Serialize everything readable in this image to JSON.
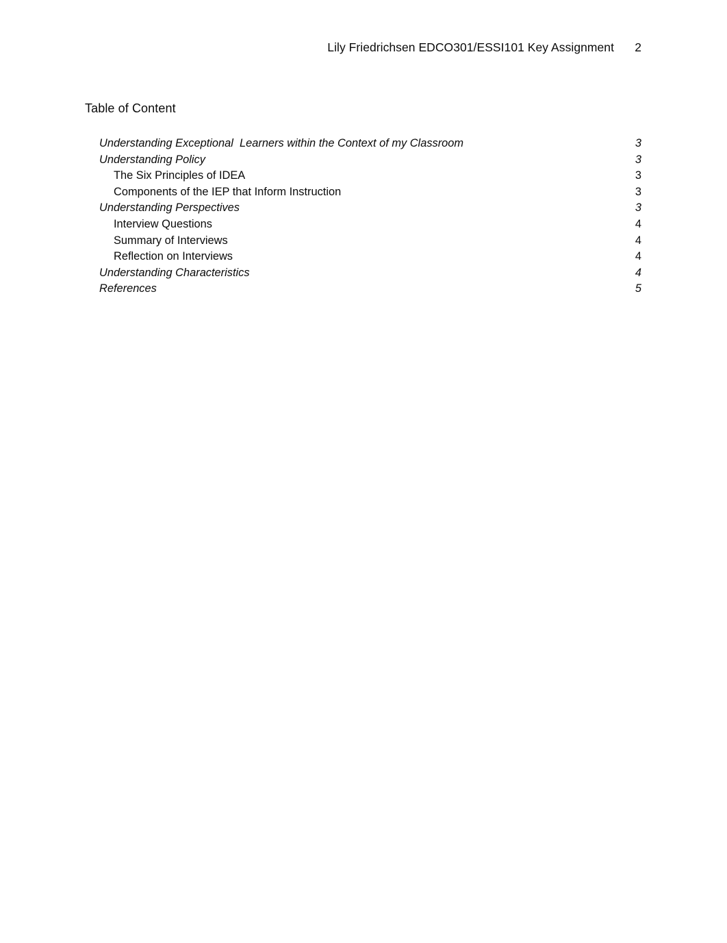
{
  "header": {
    "title": "Lily Friedrichsen EDCO301/ESSI101 Key Assignment",
    "page_number": "2"
  },
  "toc": {
    "heading": "Table of Content",
    "entries": [
      {
        "text": "Understanding Exceptional  Learners within the Context of my Classroom",
        "page": "3",
        "level": 1
      },
      {
        "text": "Understanding Policy",
        "page": "3",
        "level": 1
      },
      {
        "text": "The Six Principles of IDEA",
        "page": "3",
        "level": 2
      },
      {
        "text": "Components of the IEP that Inform Instruction",
        "page": "3",
        "level": 2
      },
      {
        "text": "Understanding Perspectives",
        "page": "3",
        "level": 1
      },
      {
        "text": "Interview Questions",
        "page": "4",
        "level": 2
      },
      {
        "text": "Summary of Interviews",
        "page": "4",
        "level": 2
      },
      {
        "text": "Reflection on Interviews",
        "page": "4",
        "level": 2
      },
      {
        "text": "Understanding Characteristics",
        "page": "4",
        "level": 1
      },
      {
        "text": "References",
        "page": "5",
        "level": 1
      }
    ]
  },
  "colors": {
    "page_background": "#ffffff",
    "text": "#0a0a0a"
  }
}
